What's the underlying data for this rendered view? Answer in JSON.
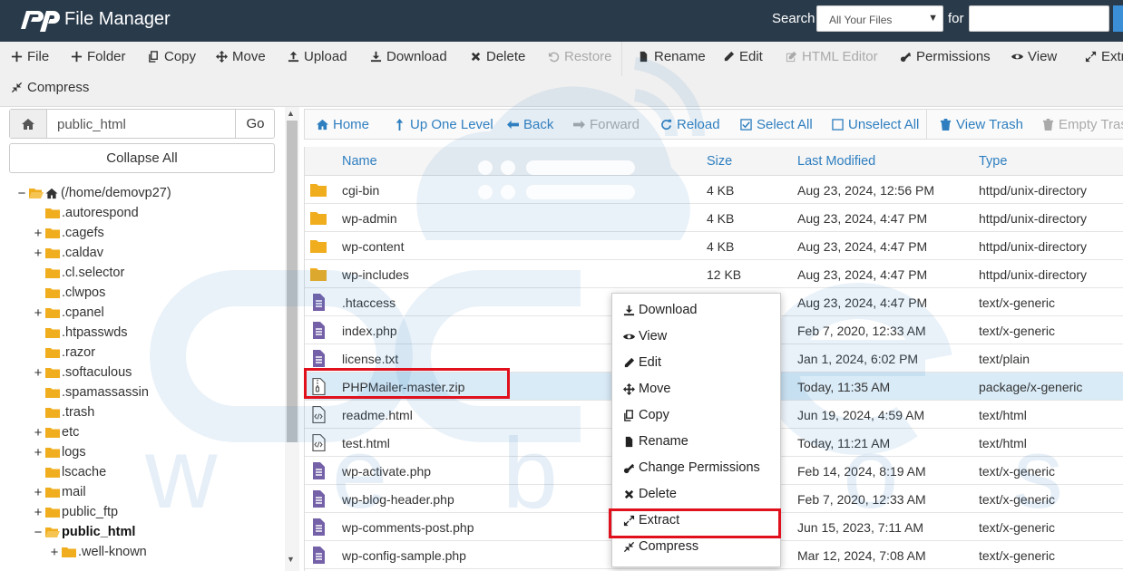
{
  "header": {
    "app_title": "File Manager",
    "search_label": "Search",
    "search_scope": "All Your Files",
    "for_label": "for",
    "search_value": ""
  },
  "toolbar": {
    "row1": [
      {
        "label": "File",
        "icon": "plus-icon",
        "disabled": false
      },
      {
        "label": "Folder",
        "icon": "plus-icon",
        "disabled": false
      },
      {
        "label": "Copy",
        "icon": "copy-icon",
        "disabled": false
      },
      {
        "label": "Move",
        "icon": "move-icon",
        "disabled": false
      },
      {
        "label": "Upload",
        "icon": "upload-icon",
        "disabled": false
      },
      {
        "label": "Download",
        "icon": "download-icon",
        "disabled": false
      },
      {
        "label": "Delete",
        "icon": "close-icon",
        "disabled": false
      },
      {
        "label": "Restore",
        "icon": "undo-icon",
        "disabled": true
      },
      {
        "label": "Rename",
        "icon": "file-icon",
        "disabled": false
      },
      {
        "label": "Edit",
        "icon": "pencil-icon",
        "disabled": false
      },
      {
        "label": "HTML Editor",
        "icon": "edit-icon",
        "disabled": true
      },
      {
        "label": "Permissions",
        "icon": "key-icon",
        "disabled": false
      },
      {
        "label": "View",
        "icon": "eye-icon",
        "disabled": false
      },
      {
        "label": "Extract",
        "icon": "expand-icon",
        "disabled": false
      }
    ],
    "row2": [
      {
        "label": "Compress",
        "icon": "compress-icon",
        "disabled": false
      }
    ]
  },
  "sidebar": {
    "path_value": "public_html",
    "go_label": "Go",
    "collapse_label": "Collapse All",
    "root_label": "(/home/demovp27)",
    "tree": [
      {
        "label": ".autorespond",
        "toggle": ""
      },
      {
        "label": ".cagefs",
        "toggle": "+"
      },
      {
        "label": ".caldav",
        "toggle": "+"
      },
      {
        "label": ".cl.selector",
        "toggle": ""
      },
      {
        "label": ".clwpos",
        "toggle": ""
      },
      {
        "label": ".cpanel",
        "toggle": "+"
      },
      {
        "label": ".htpasswds",
        "toggle": ""
      },
      {
        "label": ".razor",
        "toggle": ""
      },
      {
        "label": ".softaculous",
        "toggle": "+"
      },
      {
        "label": ".spamassassin",
        "toggle": ""
      },
      {
        "label": ".trash",
        "toggle": ""
      },
      {
        "label": "etc",
        "toggle": "+"
      },
      {
        "label": "logs",
        "toggle": "+"
      },
      {
        "label": "lscache",
        "toggle": ""
      },
      {
        "label": "mail",
        "toggle": "+"
      },
      {
        "label": "public_ftp",
        "toggle": "+"
      },
      {
        "label": "public_html",
        "toggle": "−",
        "current": true
      },
      {
        "label": ".well-known",
        "toggle": "+",
        "child": true
      }
    ]
  },
  "navbar": [
    {
      "label": "Home",
      "icon": "home-icon",
      "disabled": false
    },
    {
      "label": "Up One Level",
      "icon": "arrow-up-icon",
      "disabled": false
    },
    {
      "label": "Back",
      "icon": "arrow-left-icon",
      "disabled": false
    },
    {
      "label": "Forward",
      "icon": "arrow-right-icon",
      "disabled": true
    },
    {
      "label": "Reload",
      "icon": "reload-icon",
      "disabled": false
    },
    {
      "label": "Select All",
      "icon": "checkbox-checked-icon",
      "disabled": false
    },
    {
      "label": "Unselect All",
      "icon": "checkbox-icon",
      "disabled": false
    },
    {
      "label": "View Trash",
      "icon": "trash-icon",
      "disabled": false
    },
    {
      "label": "Empty Trash",
      "icon": "trash-icon",
      "disabled": true
    }
  ],
  "table": {
    "columns": [
      "Name",
      "Size",
      "Last Modified",
      "Type"
    ],
    "rows": [
      {
        "name": "cgi-bin",
        "size": "4 KB",
        "modified": "Aug 23, 2024, 12:56 PM",
        "type": "httpd/unix-directory",
        "icon": "folder-icon"
      },
      {
        "name": "wp-admin",
        "size": "4 KB",
        "modified": "Aug 23, 2024, 4:47 PM",
        "type": "httpd/unix-directory",
        "icon": "folder-icon"
      },
      {
        "name": "wp-content",
        "size": "4 KB",
        "modified": "Aug 23, 2024, 4:47 PM",
        "type": "httpd/unix-directory",
        "icon": "folder-icon"
      },
      {
        "name": "wp-includes",
        "size": "12 KB",
        "modified": "Aug 23, 2024, 4:47 PM",
        "type": "httpd/unix-directory",
        "icon": "folder-icon"
      },
      {
        "name": ".htaccess",
        "size": "",
        "modified": "Aug 23, 2024, 4:47 PM",
        "type": "text/x-generic",
        "icon": "text-file-icon"
      },
      {
        "name": "index.php",
        "size": "",
        "modified": "Feb 7, 2020, 12:33 AM",
        "type": "text/x-generic",
        "icon": "text-file-icon"
      },
      {
        "name": "license.txt",
        "size": "",
        "modified": "Jan 1, 2024, 6:02 PM",
        "type": "text/plain",
        "icon": "text-file-icon"
      },
      {
        "name": "PHPMailer-master.zip",
        "size": "",
        "modified": "Today, 11:35 AM",
        "type": "package/x-generic",
        "icon": "zip-file-icon",
        "selected": true
      },
      {
        "name": "readme.html",
        "size": "",
        "modified": "Jun 19, 2024, 4:59 AM",
        "type": "text/html",
        "icon": "code-file-icon"
      },
      {
        "name": "test.html",
        "size": "",
        "modified": "Today, 11:21 AM",
        "type": "text/html",
        "icon": "code-file-icon"
      },
      {
        "name": "wp-activate.php",
        "size": "",
        "modified": "Feb 14, 2024, 8:19 AM",
        "type": "text/x-generic",
        "icon": "text-file-icon"
      },
      {
        "name": "wp-blog-header.php",
        "size": "",
        "modified": "Feb 7, 2020, 12:33 AM",
        "type": "text/x-generic",
        "icon": "text-file-icon"
      },
      {
        "name": "wp-comments-post.php",
        "size": "",
        "modified": "Jun 15, 2023, 7:11 AM",
        "type": "text/x-generic",
        "icon": "text-file-icon"
      },
      {
        "name": "wp-config-sample.php",
        "size": "",
        "modified": "Mar 12, 2024, 7:08 AM",
        "type": "text/x-generic",
        "icon": "text-file-icon"
      }
    ]
  },
  "context_menu": [
    {
      "label": "Download",
      "icon": "download-icon"
    },
    {
      "label": "View",
      "icon": "eye-icon"
    },
    {
      "label": "Edit",
      "icon": "pencil-icon"
    },
    {
      "label": "Move",
      "icon": "move-icon"
    },
    {
      "label": "Copy",
      "icon": "copy-icon"
    },
    {
      "label": "Rename",
      "icon": "file-icon"
    },
    {
      "label": "Change Permissions",
      "icon": "key-icon"
    },
    {
      "label": "Delete",
      "icon": "close-icon"
    },
    {
      "label": "Extract",
      "icon": "expand-icon",
      "highlighted": true
    },
    {
      "label": "Compress",
      "icon": "compress-icon"
    }
  ],
  "watermark": {
    "letters": "w e b h o s t i n g",
    "color": "#2f7fc0"
  },
  "colors": {
    "header_bg": "#293a4a",
    "link_blue": "#2f7fc0",
    "highlight_red": "#e0101c",
    "selected_row": "#d9ebf7",
    "folder": "#f0ad1e",
    "file_icon": "#7461a8"
  }
}
